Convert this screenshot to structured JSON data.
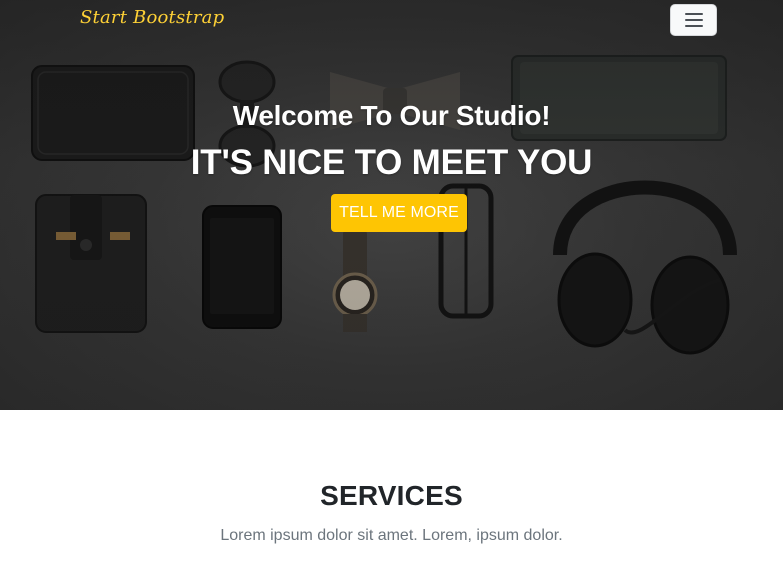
{
  "navbar": {
    "brand": "Start Bootstrap",
    "toggler_icon": "hamburger-menu-icon"
  },
  "hero": {
    "subheading": "Welcome To Our Studio!",
    "heading": "IT'S NICE TO MEET YOU",
    "cta_label": "TELL ME MORE"
  },
  "services": {
    "heading": "SERVICES",
    "subheading": "Lorem ipsum dolor sit amet. Lorem, ipsum dolor."
  },
  "colors": {
    "brand": "#fed136",
    "accent": "#fec503",
    "heading_text": "#212529",
    "muted_text": "#6c757d",
    "hero_background": "#3a3a3a"
  }
}
